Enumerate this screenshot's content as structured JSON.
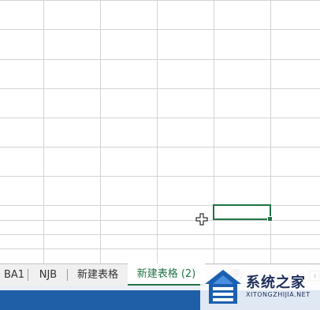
{
  "sheet_tabs": [
    {
      "label": "BA1",
      "active": false
    },
    {
      "label": "NJB",
      "active": false
    },
    {
      "label": "新建表格",
      "active": false
    },
    {
      "label": "新建表格 (2)",
      "active": true
    }
  ],
  "add_sheet": "⊕",
  "watermark": {
    "title": "系统之家",
    "url": "XITONGZHIJIA.NET"
  },
  "colors": {
    "accent": "#217346",
    "gridline": "#d4d4d4",
    "statusbar": "#1f5fa8"
  }
}
